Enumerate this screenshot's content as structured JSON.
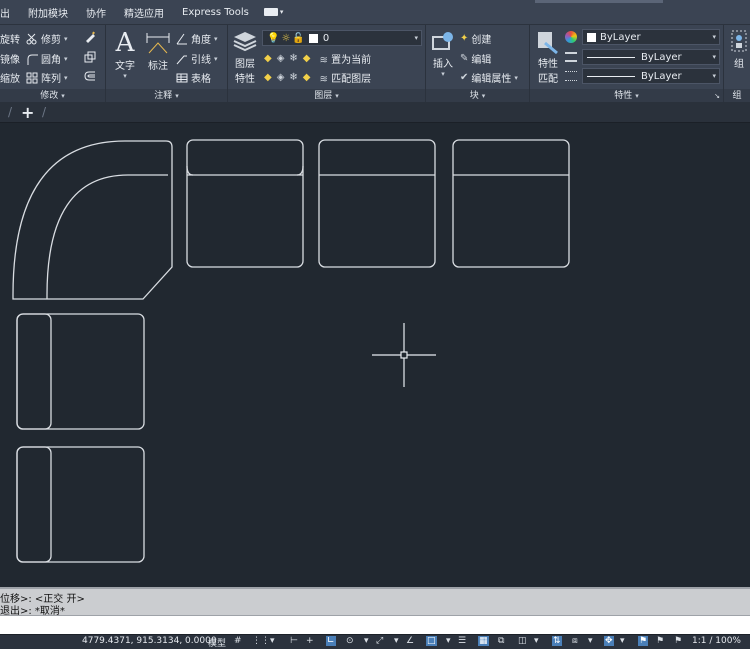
{
  "menu": {
    "items": [
      "出",
      "附加模块",
      "协作",
      "精选应用",
      "Express Tools"
    ]
  },
  "ribbon": {
    "modify": {
      "title": "修改",
      "col1": [
        "旋转",
        "镜像",
        "缩放"
      ],
      "col2": [
        "修剪",
        "圆角",
        "阵列"
      ]
    },
    "annotation": {
      "title": "注释",
      "text_label": "文字",
      "dim_label": "标注",
      "angle": "角度",
      "leader": "引线",
      "table": "表格"
    },
    "layers": {
      "title": "图层",
      "props_label_1": "图层",
      "props_label_2": "特性",
      "layer_name": "0",
      "set_current": "置为当前",
      "match_layer": "匹配图层"
    },
    "block": {
      "title": "块",
      "insert": "插入",
      "create": "创建",
      "edit": "编辑",
      "edit_attr": "编辑属性"
    },
    "properties": {
      "title": "特性",
      "match_1": "特性",
      "match_2": "匹配",
      "color": "ByLayer",
      "linetype": "ByLayer",
      "lineweight": "ByLayer"
    },
    "group": {
      "title": "组",
      "label": "组"
    }
  },
  "tabs": {
    "new_tab": "+"
  },
  "command": {
    "line1": "位移>:  <正交  开>",
    "line2": "退出>: *取消*",
    "input": ""
  },
  "status": {
    "coords": "4779.4371, 915.3134, 0.0000",
    "model": "模型",
    "zoom": "1:1 / 100%"
  }
}
